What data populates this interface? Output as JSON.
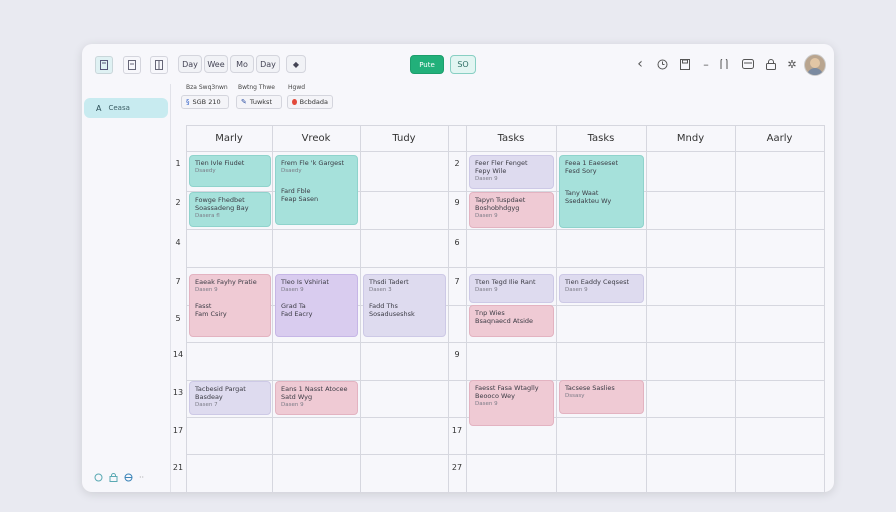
{
  "toolbar": {
    "view_buttons": [
      "Day",
      "Wee",
      "Mo",
      "Day"
    ],
    "primary_button": "Pute",
    "secondary_button": "SO"
  },
  "filters": {
    "label1": "Bza Swq3nwn",
    "label2": "Bwtng Thwe",
    "label3": "Hgwd",
    "chip1": "SGB 210",
    "chip2": "Tuwkst",
    "chip3": "Bcbdada"
  },
  "sidebar": {
    "item_label": "Ceasa",
    "item_letter": "A"
  },
  "columns": [
    "Marly",
    "Vreok",
    "Tudy",
    "Tasks",
    "Tasks",
    "Mndy",
    "Aarly"
  ],
  "left_rows": [
    "1",
    "2",
    "4",
    "7",
    "5",
    "14",
    "13",
    "17",
    "21"
  ],
  "right_rows": [
    "2",
    "9",
    "6",
    "7",
    "",
    "9",
    "",
    "17",
    "27"
  ],
  "events": [
    {
      "title1": "Tien Ivle Fiudet",
      "sub1": "Dsaedy",
      "title2": "",
      "sub2": ""
    },
    {
      "title1": "Fowge Fhedbet",
      "sub1": "Soassadeng Bay",
      "title2": "",
      "sub2": "Dasera fl"
    },
    {
      "title1": "Frem Fle 'k Gargest",
      "sub1": "Dsaedy",
      "title2": "Fard Fble",
      "sub2": "Feap Sasen"
    },
    {
      "title1": "Feer Fler Fenget",
      "sub1": "Fepy Wile",
      "title2": "",
      "sub2": "Dasen 9"
    },
    {
      "title1": "Tapyn Tuspdaet",
      "sub1": "Boshobhdgyg",
      "title2": "",
      "sub2": "Dasen 9"
    },
    {
      "title1": "Feea 1 Eaeseset",
      "sub1": "Fesd Sory",
      "title2": "Tany Waat",
      "sub2": "Ssedakteu Wy"
    },
    {
      "title1": "Eaeak Fayhy Pratie",
      "sub1": "Dasen 9",
      "title2": "Fasst",
      "sub2": "Fam Csiry"
    },
    {
      "title1": "Tleo Is Vshiriat",
      "sub1": "Dasen 9",
      "title2": "Grad Ta",
      "sub2": "Fad Eacry"
    },
    {
      "title1": "Thsdi Tadert",
      "sub1": "Dasen 3",
      "title2": "Fadd Ths",
      "sub2": "Sosaduseshsk"
    },
    {
      "title1": "Tten Tegd Ilie Rant",
      "sub1": "Dasen 9",
      "title2": "Tnp Wies",
      "sub2": "Bsaqnaecd Atside"
    },
    {
      "title1": "Tien Eaddy Ceqsest",
      "sub1": "Dasen 9",
      "title2": "",
      "sub2": ""
    },
    {
      "title1": "Tacbesid Pargat",
      "sub1": "Basdeay",
      "title2": "",
      "sub2": "Dasen 7"
    },
    {
      "title1": "Eans 1 Nasst Atocee",
      "sub1": "Satd Wyg",
      "title2": "",
      "sub2": "Dasen 9"
    },
    {
      "title1": "Faesst Fasa Wtaglly",
      "sub1": "Beooco Wey",
      "title2": "",
      "sub2": "Dasen 9"
    },
    {
      "title1": "Tacsese Saslies",
      "sub1": "Dssasy",
      "title2": "",
      "sub2": ""
    }
  ]
}
